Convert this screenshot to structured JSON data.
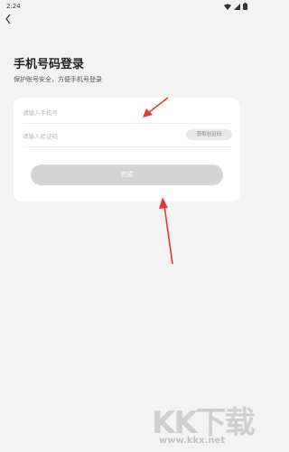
{
  "status_bar": {
    "time": "2:24"
  },
  "header": {
    "title": "手机号码登录",
    "subtitle": "保护账号安全，方便手机号登录"
  },
  "form": {
    "phone_placeholder": "请输入手机号",
    "code_placeholder": "请输入验证码",
    "get_code_label": "获取验证码",
    "submit_label": "完成"
  },
  "watermark": {
    "logo_text": "KK下载",
    "url": "www.kkx.net"
  },
  "icons": [
    "back-arrow-icon",
    "wifi-icon",
    "signal-icon",
    "battery-icon"
  ],
  "colors": {
    "annotation_arrow": "#e53935",
    "card_bg": "#ffffff",
    "page_bg": "#f3f3f3",
    "button_disabled": "#d4d4d4"
  }
}
